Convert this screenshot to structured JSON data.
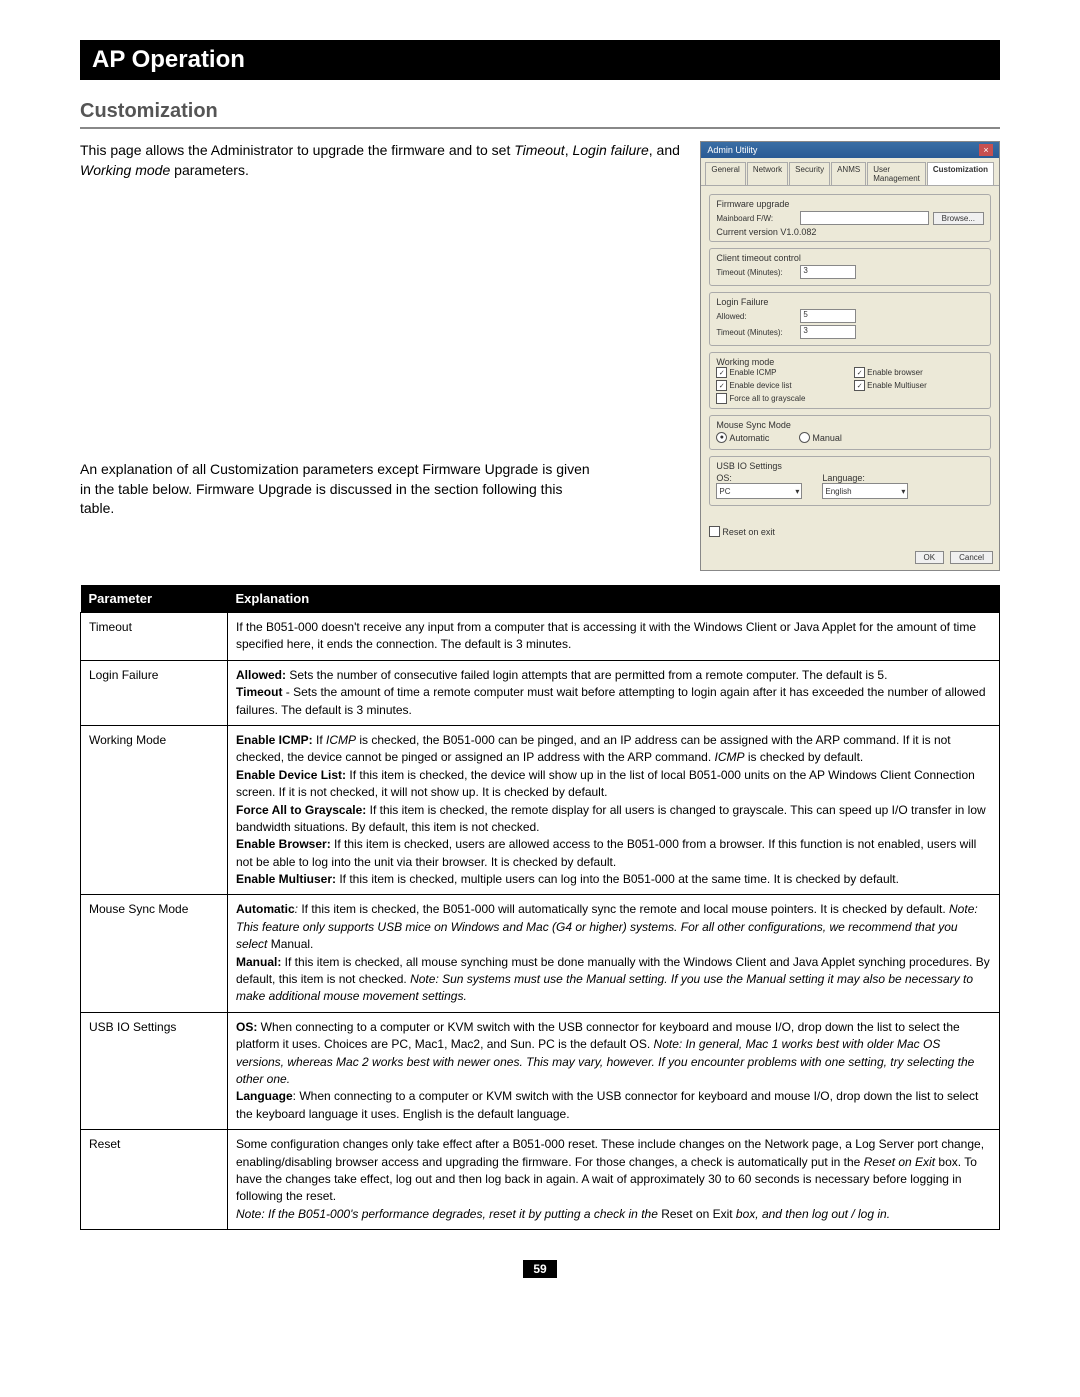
{
  "title": "AP Operation",
  "subtitle": "Customization",
  "intro1_a": "This page allows the Administrator to upgrade the firmware and to set ",
  "intro1_b": "Timeout",
  "intro1_c": ", ",
  "intro1_d": "Login failure",
  "intro1_e": ", and ",
  "intro1_f": "Working mode",
  "intro1_g": " parameters.",
  "intro2": "An explanation of all Customization parameters except Firmware Upgrade is given in the table below. Firmware Upgrade is discussed in the section following this table.",
  "dialog": {
    "title": "Admin Utility",
    "tabs": [
      "General",
      "Network",
      "Security",
      "ANMS",
      "User Management",
      "Customization"
    ],
    "groups": {
      "fw": {
        "legend": "Firmware upgrade",
        "file": "Mainboard F/W:",
        "cur": "Current version V1.0.082",
        "browse": "Browse..."
      },
      "timeout": {
        "legend": "Client timeout control",
        "label": "Timeout (Minutes):",
        "val": "3"
      },
      "login": {
        "legend": "Login Failure",
        "allowed": "Allowed:",
        "allowed_v": "5",
        "tmo": "Timeout (Minutes):",
        "tmo_v": "3"
      },
      "wmode": {
        "legend": "Working mode",
        "c1": "Enable ICMP",
        "c2": "Enable browser",
        "c3": "Enable device list",
        "c4": "Enable Multiuser",
        "c5": "Force all to grayscale"
      },
      "mouse": {
        "legend": "Mouse Sync Mode",
        "auto": "Automatic",
        "manual": "Manual"
      },
      "usb": {
        "legend": "USB IO Settings",
        "os": "OS:",
        "os_v": "PC",
        "lang": "Language:",
        "lang_v": "English"
      },
      "reset": "Reset on exit"
    },
    "ok": "OK",
    "cancel": "Cancel"
  },
  "table": {
    "headers": [
      "Parameter",
      "Explanation"
    ],
    "rows": [
      {
        "param": "Timeout",
        "html": "If the B051-000 doesn't receive any input from a computer that is accessing it with the Windows Client or Java Applet for the amount of time specified here, it ends the connection. The default is 3 minutes."
      },
      {
        "param": "Login Failure",
        "html": "<b>Allowed:</b> Sets the number of consecutive failed login attempts that are permitted from a remote computer. The default is 5.<br><b>Timeout</b> - Sets the amount of time a remote computer must wait before attempting to login again after it has exceeded the number of allowed failures. The default is 3 minutes."
      },
      {
        "param": "Working Mode",
        "html": "<b>Enable ICMP:</b> If <i>ICMP</i> is checked, the B051-000 can be pinged, and an IP address can be assigned with the ARP command. If it is not checked, the device cannot be pinged or assigned an IP address with the ARP command. <i>ICMP</i> is checked by default.<br><b>Enable Device List:</b> If this item is checked, the device will show up in the list of local B051-000 units on the AP Windows Client Connection screen. If it is not checked, it will not show up. It is checked by default.<br><b>Force All to Grayscale:</b> If this item is checked, the remote display for all users is changed to grayscale. This can speed up I/O transfer in low bandwidth situations. By default, this item is not checked.<br><b>Enable Browser:</b> If this item is checked, users are allowed access to the B051-000 from a browser. If this function is not enabled, users will not be able to log into the unit via their browser. It is checked by default.<br><b>Enable Multiuser:</b> If this item is checked, multiple users can log into the B051-000 at the same time. It is checked by default."
      },
      {
        "param": "Mouse Sync Mode",
        "html": "<b>Automatic</b><i>:</i> If this item is checked, the B051-000 will automatically sync the remote and local mouse pointers. It is checked by default. <i>Note: This feature only supports USB mice on Windows and Mac (G4 or higher) systems. For all other configurations, we recommend that you select</i> Manual.<br><b>Manual:</b> If this item is checked, all mouse synching must be done manually with the Windows Client and Java Applet synching procedures. By default, this item is not checked. <i>Note: Sun systems must use the Manual setting. If you use the Manual setting it may also be necessary to make additional mouse movement settings.</i>"
      },
      {
        "param": "USB IO Settings",
        "html": "<b>OS:</b> When connecting to a computer or KVM switch with the USB connector for keyboard and mouse I/O, drop down the list to select the platform it uses. Choices are PC, Mac1, Mac2, and Sun. PC is the default OS. <i>Note: In general, Mac 1 works best with older Mac OS versions, whereas Mac 2 works best with newer ones. This may vary, however. If you encounter problems with one setting, try selecting the other one.</i><br><b>Language</b>: When connecting to a computer or KVM switch with the USB connector for keyboard and mouse I/O, drop down the list to select the keyboard language it uses. English is the default language."
      },
      {
        "param": "Reset",
        "html": "Some configuration changes only take effect after a B051-000 reset. These include changes on the Network page, a Log Server port change, enabling/disabling browser access and upgrading the firmware. For those changes, a check is automatically put in the <i>Reset on Exit</i> box. To have the changes take effect, log out and then log back in again. A wait of approximately 30 to 60 seconds is necessary before logging in following the reset.<br><i>Note: If the B051-000's performance degrades, reset it by putting a check in the</i> Reset on Exit <i>box, and then log out / log in.</i>"
      }
    ]
  },
  "page_number": "59"
}
